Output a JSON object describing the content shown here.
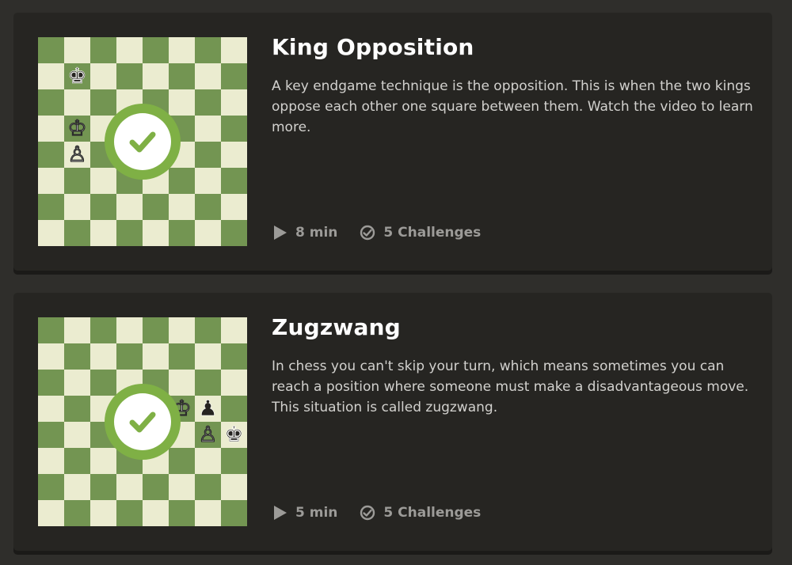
{
  "lessons": [
    {
      "title": "King Opposition",
      "description": "A key endgame technique is the opposition. This is when the two kings oppose each other one square between them. Watch the video to learn more.",
      "duration": "8 min",
      "challenges": "5 Challenges",
      "completed": true,
      "pieces": [
        {
          "square": "b7",
          "piece": "black-king"
        },
        {
          "square": "b5",
          "piece": "white-king"
        },
        {
          "square": "b4",
          "piece": "white-pawn"
        }
      ]
    },
    {
      "title": "Zugzwang",
      "description": "In chess you can't skip your turn, which means sometimes you can reach a position where someone must make a disadvantageous move. This situation is called zugzwang.",
      "duration": "5 min",
      "challenges": "5 Challenges",
      "completed": true,
      "pieces": [
        {
          "square": "f5",
          "piece": "white-king"
        },
        {
          "square": "g5",
          "piece": "black-pawn"
        },
        {
          "square": "g4",
          "piece": "white-pawn"
        },
        {
          "square": "h4",
          "piece": "black-king"
        }
      ]
    }
  ],
  "colors": {
    "page_background": "#2f2e2b",
    "card_background": "#262522",
    "board_light": "#ebecd0",
    "board_dark": "#739552",
    "check_green": "#7fb045",
    "meta_text": "#9c9b98"
  },
  "icons": {
    "play": "play-icon",
    "challenges": "check-circle-icon",
    "completed": "checkmark-icon"
  }
}
